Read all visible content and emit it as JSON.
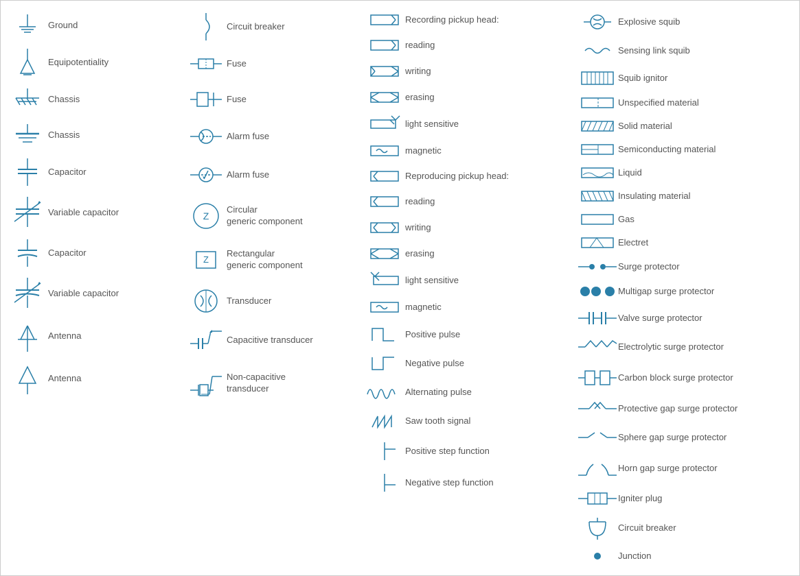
{
  "col1": [
    {
      "id": "ground",
      "label": "Ground"
    },
    {
      "id": "equipotentiality",
      "label": "Equipotentiality"
    },
    {
      "id": "chassis1",
      "label": "Chassis"
    },
    {
      "id": "chassis2",
      "label": "Chassis"
    },
    {
      "id": "capacitor1",
      "label": "Capacitor"
    },
    {
      "id": "variable-capacitor1",
      "label": "Variable capacitor"
    },
    {
      "id": "capacitor2",
      "label": "Capacitor"
    },
    {
      "id": "variable-capacitor2",
      "label": "Variable capacitor"
    },
    {
      "id": "antenna1",
      "label": "Antenna"
    },
    {
      "id": "antenna2",
      "label": "Antenna"
    }
  ],
  "col2": [
    {
      "id": "circuit-breaker",
      "label": "Circuit breaker"
    },
    {
      "id": "fuse1",
      "label": "Fuse"
    },
    {
      "id": "fuse2",
      "label": "Fuse"
    },
    {
      "id": "alarm-fuse1",
      "label": "Alarm fuse"
    },
    {
      "id": "alarm-fuse2",
      "label": "Alarm fuse"
    },
    {
      "id": "circular-generic",
      "label": "Circular\ngeneric component"
    },
    {
      "id": "rectangular-generic",
      "label": "Rectangular\ngeneric component"
    },
    {
      "id": "transducer",
      "label": "Transducer"
    },
    {
      "id": "capacitive-transducer",
      "label": "Capacitive transducer"
    },
    {
      "id": "non-capacitive-transducer",
      "label": "Non-capacitive\ntransducer"
    }
  ],
  "col3": [
    {
      "id": "rph-label",
      "label": "Recording pickup head:",
      "header": true
    },
    {
      "id": "rph-reading",
      "label": "reading"
    },
    {
      "id": "rph-writing",
      "label": "writing"
    },
    {
      "id": "rph-erasing",
      "label": "erasing"
    },
    {
      "id": "rph-light",
      "label": "light sensitive"
    },
    {
      "id": "rph-magnetic",
      "label": "magnetic"
    },
    {
      "id": "repro-label",
      "label": "Reproducing pickup head:",
      "header": true
    },
    {
      "id": "repro-reading",
      "label": "reading"
    },
    {
      "id": "repro-writing",
      "label": "writing"
    },
    {
      "id": "repro-erasing",
      "label": "erasing"
    },
    {
      "id": "repro-light",
      "label": "light sensitive"
    },
    {
      "id": "repro-magnetic",
      "label": "magnetic"
    },
    {
      "id": "pos-pulse",
      "label": "Positive pulse"
    },
    {
      "id": "neg-pulse",
      "label": "Negative pulse"
    },
    {
      "id": "alt-pulse",
      "label": "Alternating pulse"
    },
    {
      "id": "saw-tooth",
      "label": "Saw tooth signal"
    },
    {
      "id": "pos-step",
      "label": "Positive step function"
    },
    {
      "id": "neg-step",
      "label": "Negative step function"
    }
  ],
  "col4": [
    {
      "id": "explosive-squib",
      "label": "Explosive squib"
    },
    {
      "id": "sensing-link-squib",
      "label": "Sensing link squib"
    },
    {
      "id": "squib-ignitor",
      "label": "Squib ignitor"
    },
    {
      "id": "unspecified-material",
      "label": "Unspecified material"
    },
    {
      "id": "solid-material",
      "label": "Solid material"
    },
    {
      "id": "semiconducting",
      "label": "Semiconducting material"
    },
    {
      "id": "liquid",
      "label": "Liquid"
    },
    {
      "id": "insulating",
      "label": "Insulating material"
    },
    {
      "id": "gas",
      "label": "Gas"
    },
    {
      "id": "electret",
      "label": "Electret"
    },
    {
      "id": "surge-protector",
      "label": "Surge protector"
    },
    {
      "id": "multigap-surge",
      "label": "Multigap surge protector"
    },
    {
      "id": "valve-surge",
      "label": "Valve surge protector"
    },
    {
      "id": "electrolytic-surge",
      "label": "Electrolytic surge protector"
    },
    {
      "id": "carbon-block",
      "label": "Carbon block surge protector"
    },
    {
      "id": "protective-gap",
      "label": "Protective gap surge protector"
    },
    {
      "id": "sphere-gap",
      "label": "Sphere gap surge protector"
    },
    {
      "id": "horn-gap",
      "label": "Horn gap surge protector"
    },
    {
      "id": "igniter-plug",
      "label": "Igniter plug"
    },
    {
      "id": "circuit-breaker2",
      "label": "Circuit breaker"
    },
    {
      "id": "junction",
      "label": "Junction"
    }
  ]
}
